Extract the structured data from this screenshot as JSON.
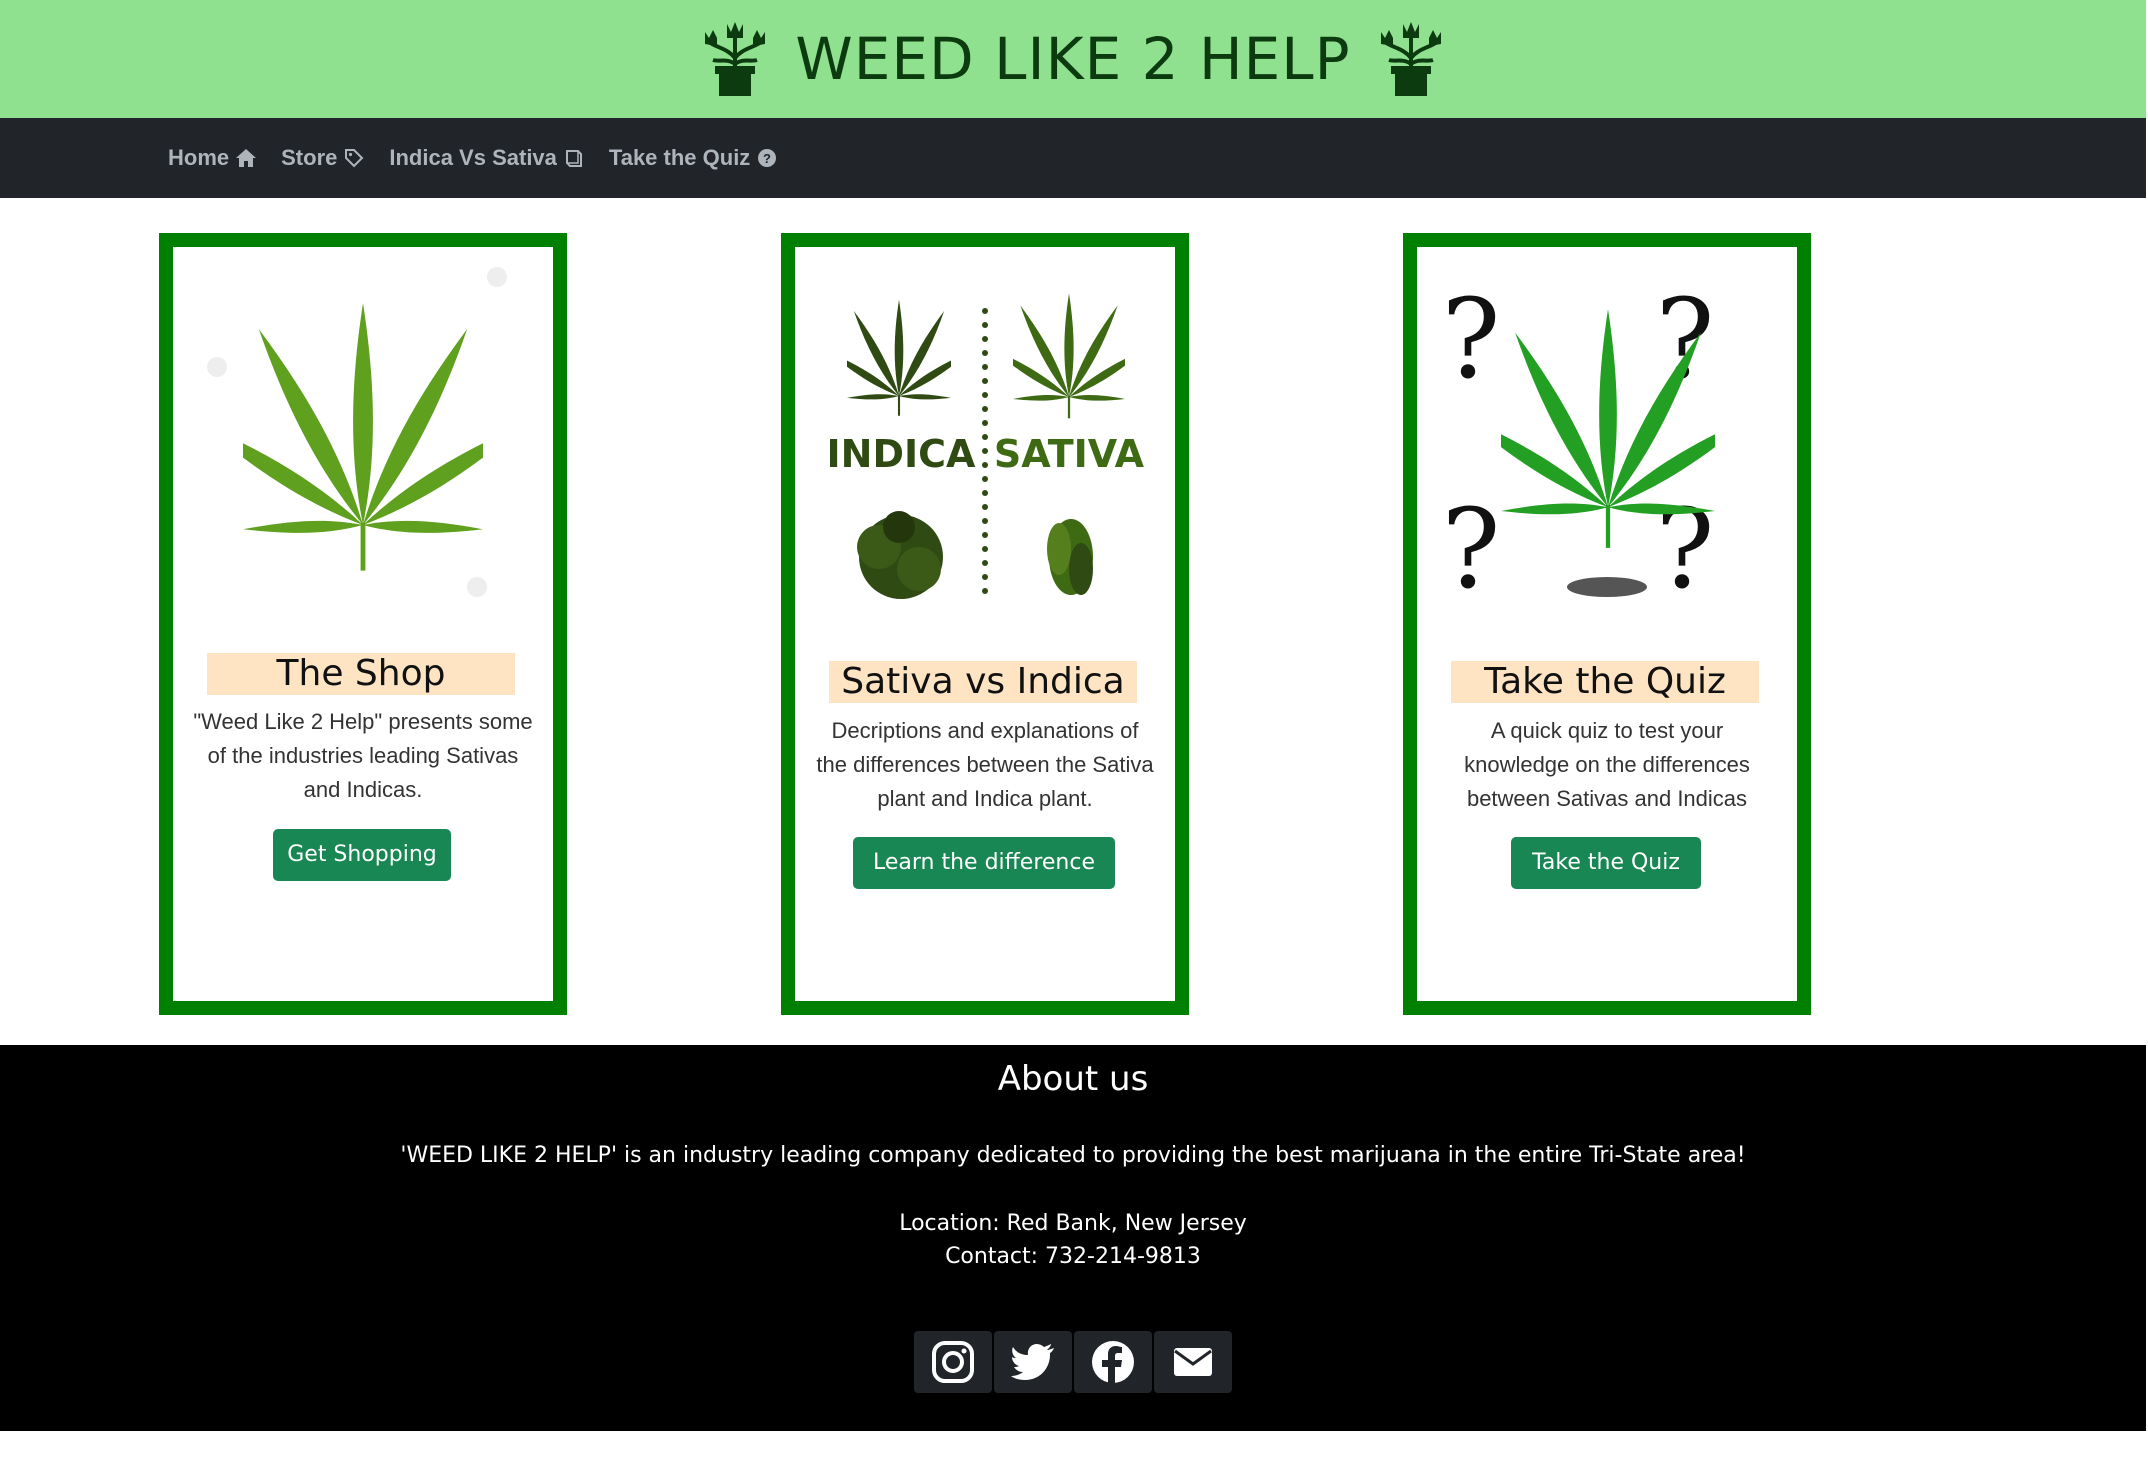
{
  "header": {
    "title": "WEED LIKE 2 HELP"
  },
  "nav": {
    "items": [
      {
        "label": "Home",
        "icon": "home-icon"
      },
      {
        "label": "Store",
        "icon": "tag-icon"
      },
      {
        "label": "Indica Vs Sativa",
        "icon": "book-icon"
      },
      {
        "label": "Take the Quiz",
        "icon": "question-circle-icon"
      }
    ]
  },
  "cards": [
    {
      "title": "The Shop",
      "text": "\"Weed Like 2 Help\" presents some of the industries leading Sativas and Indicas.",
      "button": "Get Shopping",
      "image": "cannabis-leaf"
    },
    {
      "title": "Sativa vs Indica",
      "text": "Decriptions and explanations of the differences between the Sativa plant and Indica plant.",
      "button": "Learn the difference",
      "image": "indica-sativa-comparison",
      "image_labels": {
        "left": "INDICA",
        "right": "SATIVA"
      }
    },
    {
      "title": "Take the Quiz",
      "text": "A quick quiz to test your knowledge on the differences between Sativas and Indicas",
      "button": "Take the Quiz",
      "image": "leaf-with-question-marks"
    }
  ],
  "footer": {
    "about_title": "About us",
    "about_text": "'WEED LIKE 2 HELP' is an industry leading company dedicated to providing the best marijuana in the entire Tri-State area!",
    "location": "Location: Red Bank, New Jersey",
    "contact": "Contact: 732-214-9813",
    "socials": [
      "instagram-icon",
      "twitter-icon",
      "facebook-icon",
      "email-icon"
    ]
  },
  "colors": {
    "header_bg": "#8fe08f",
    "navbar_bg": "#212529",
    "card_border": "#008000",
    "card_title_bg": "#ffe4c4",
    "button_bg": "#198754",
    "footer_bg": "#000000"
  }
}
